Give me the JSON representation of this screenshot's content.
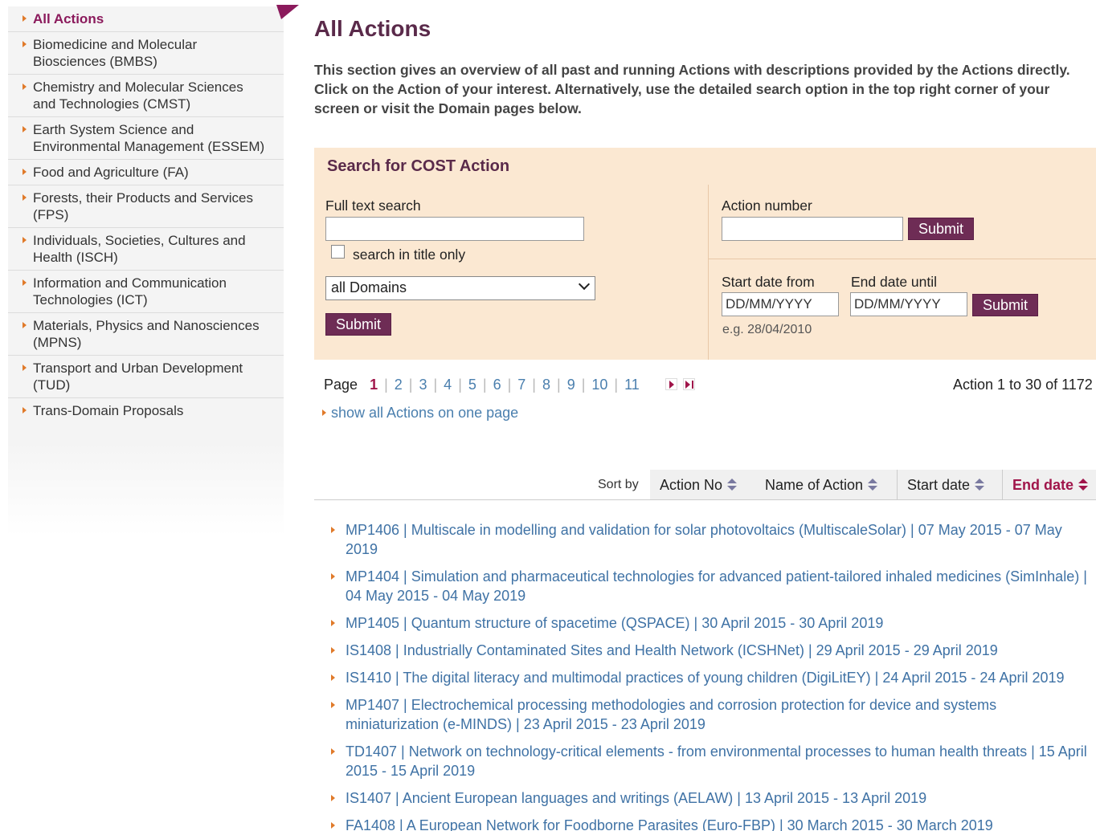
{
  "sidebar": {
    "items": [
      {
        "label": "All Actions",
        "active": true
      },
      {
        "label": "Biomedicine and Molecular Biosciences (BMBS)"
      },
      {
        "label": "Chemistry and Molecular Sciences and Technologies (CMST)"
      },
      {
        "label": "Earth System Science and Environmental Management (ESSEM)"
      },
      {
        "label": "Food and Agriculture (FA)"
      },
      {
        "label": "Forests, their Products and Services (FPS)"
      },
      {
        "label": "Individuals, Societies, Cultures and Health (ISCH)"
      },
      {
        "label": "Information and Communication Technologies (ICT)"
      },
      {
        "label": "Materials, Physics and Nanosciences (MPNS)"
      },
      {
        "label": "Transport and Urban Development (TUD)"
      },
      {
        "label": "Trans-Domain Proposals"
      }
    ]
  },
  "page": {
    "title": "All Actions",
    "intro": "This section gives an overview of all past and running Actions with descriptions provided by the Actions directly. Click on the Action of your interest. Alternatively, use the detailed search option in the top right corner of your screen or visit the Domain pages below."
  },
  "search": {
    "heading": "Search for COST Action",
    "fulltext_label": "Full text search",
    "fulltext_value": "",
    "title_only_label": "search in title only",
    "domain_selected": "all Domains",
    "submit_label": "Submit",
    "action_number_label": "Action number",
    "action_number_value": "",
    "start_date_label": "Start date from",
    "end_date_label": "End date until",
    "date_placeholder": "DD/MM/YYYY",
    "date_hint": "e.g. 28/04/2010"
  },
  "pagination": {
    "label": "Page",
    "pages": [
      "1",
      "2",
      "3",
      "4",
      "5",
      "6",
      "7",
      "8",
      "9",
      "10",
      "11"
    ],
    "current": "1",
    "count_text": "Action 1 to 30 of 1172",
    "show_all": "show all Actions on one page"
  },
  "sort": {
    "label": "Sort by",
    "columns": [
      "Action No",
      "Name of Action",
      "Start date",
      "End date"
    ],
    "active": "End date"
  },
  "actions": [
    "MP1406 | Multiscale in modelling and validation for solar photovoltaics (MultiscaleSolar) | 07 May 2015 - 07 May 2019",
    "MP1404 | Simulation and pharmaceutical technologies for advanced patient-tailored inhaled medicines (SimInhale) | 04 May 2015 - 04 May 2019",
    "MP1405 | Quantum structure of spacetime (QSPACE) | 30 April 2015 - 30 April 2019",
    "IS1408 | Industrially Contaminated Sites and Health Network (ICSHNet) | 29 April 2015 - 29 April 2019",
    "IS1410 | The digital literacy and multimodal practices of young children (DigiLitEY) | 24 April 2015 - 24 April 2019",
    "MP1407 | Electrochemical processing methodologies and corrosion protection for device and systems miniaturization (e-MINDS) | 23 April 2015 - 23 April 2019",
    "TD1407 | Network on technology-critical elements - from environmental processes to human health threats | 15 April 2015 - 15 April 2019",
    "IS1407 | Ancient European languages and writings (AELAW) | 13 April 2015 - 13 April 2019",
    "FA1408 | A European Network for Foodborne Parasites (Euro-FBP) | 30 March 2015 - 30 March 2019"
  ]
}
